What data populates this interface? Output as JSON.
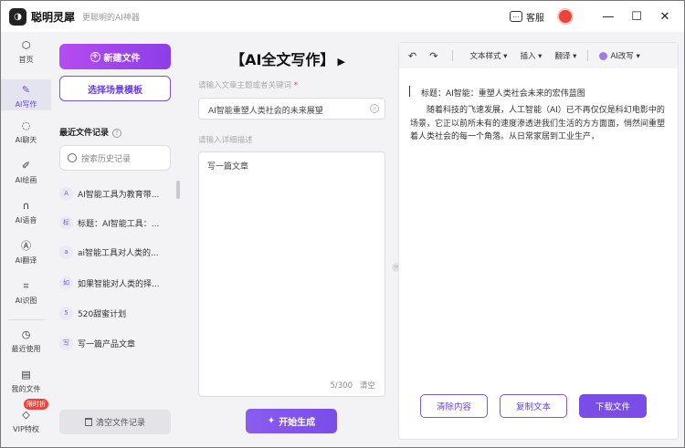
{
  "app": {
    "logo_glyph": "◑",
    "name": "聪明灵犀",
    "slogan": "更聪明的AI神器",
    "service_label": "客服",
    "minimize": "—",
    "maximize": "☐",
    "close": "✕"
  },
  "nav": [
    {
      "label": "首页"
    },
    {
      "label": "AI写作"
    },
    {
      "label": "AI聊天"
    },
    {
      "label": "AI绘画"
    },
    {
      "label": "AI语音"
    },
    {
      "label": "AI翻译"
    },
    {
      "label": "AI识图"
    },
    {
      "label": "最近使用"
    },
    {
      "label": "我的文件"
    },
    {
      "label": "VIP特权"
    }
  ],
  "vip_badge": "限时折",
  "left_panel": {
    "new_file": "新建文件",
    "scene_template": "选择场景模板",
    "recent_title": "最近文件记录",
    "search_placeholder": "搜索历史记录",
    "history": [
      {
        "tag": "A",
        "text": "AI智能工具为教育带..."
      },
      {
        "tag": "标",
        "text": "标题：AI智能工具：..."
      },
      {
        "tag": "a",
        "text": "ai智能工具对人类的..."
      },
      {
        "tag": "如",
        "text": "如果智能对人类的择..."
      },
      {
        "tag": "5",
        "text": "520甜蜜计划"
      },
      {
        "tag": "写",
        "text": "写一篇产品文章"
      }
    ],
    "clear_records": "清空文件记录"
  },
  "middle": {
    "title": "【AI全文写作】",
    "play": "▶",
    "topic_label": "请输入文章主题或者关键词",
    "required_mark": "*",
    "topic_value": "AI智能重塑人类社会的未来展望",
    "detail_label": "请输入详细描述",
    "detail_value": "写一篇文章",
    "counter": "5/300",
    "clear": "清空",
    "generate": "开始生成"
  },
  "editor": {
    "toolbar": {
      "undo": "↶",
      "redo": "↷",
      "text_style": "文本样式",
      "insert": "插入",
      "translate": "翻译",
      "ai_rewrite": "AI改写"
    },
    "title_line": "标题：AI智能：重塑人类社会未来的宏伟蓝图",
    "body": "随着科技的飞速发展，人工智能（AI）已不再仅仅是科幻电影中的场景，它正以前所未有的速度渗透进我们生活的方方面面，悄然间重塑着人类社会的每一个角落。从日常家居到工业生产，",
    "clear_content": "清除内容",
    "copy_text": "复制文本",
    "download": "下载文件"
  },
  "colors": {
    "accent": "#7a4de6",
    "gradient_start": "#b64cf0",
    "badge": "#f0433b"
  }
}
